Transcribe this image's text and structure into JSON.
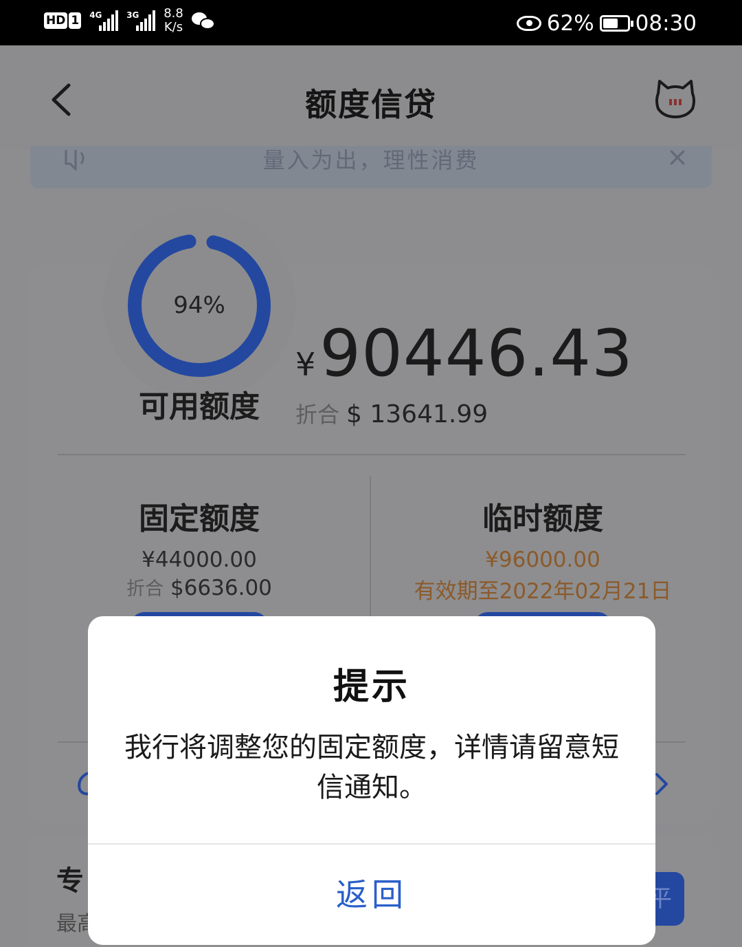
{
  "status_bar": {
    "hd_label": "HD",
    "sim_label": "1",
    "signal1_label": "4G",
    "signal2_label": "3G",
    "speed_value": "8.8",
    "speed_unit": "K/s",
    "battery_percent": "62%",
    "battery_level": 0.62,
    "time": "08:30",
    "icons": [
      "hd-icon",
      "signal-4g-icon",
      "signal-3g-icon",
      "wechat-icon",
      "eye-icon",
      "battery-icon"
    ]
  },
  "nav": {
    "title": "额度信贷",
    "icons": [
      "back-arrow-icon",
      "cat-mascot-icon"
    ]
  },
  "notice": {
    "text": "量入为出，理性消费",
    "close_glyph": "×",
    "icon": "speaker-icon"
  },
  "credit": {
    "usage_percent_label": "94%",
    "usage_fraction": 0.94,
    "available_label": "可用额度",
    "currency_symbol": "¥",
    "available_amount": "90446.43",
    "usd_prefix": "折合",
    "usd_amount": "$ 13641.99",
    "fixed": {
      "title": "固定额度",
      "amount": "¥44000.00",
      "usd_prefix": "折合",
      "usd_amount": "$6636.00"
    },
    "temporary": {
      "title": "临时额度",
      "amount": "¥96000.00",
      "validity": "有效期至2022年02月21日"
    }
  },
  "card2": {
    "title_fragment": "专",
    "sub_fragment": "最高",
    "button_fragment": "平"
  },
  "dialog": {
    "title": "提示",
    "message": "我行将调整您的固定额度，详情请留意短信通知。",
    "button": "返回"
  },
  "colors": {
    "ring_blue": "#2448a0",
    "overlay": "#8d8d90",
    "dialog_button": "#2a5fc8",
    "temporary_text": "#8b5a2a"
  }
}
